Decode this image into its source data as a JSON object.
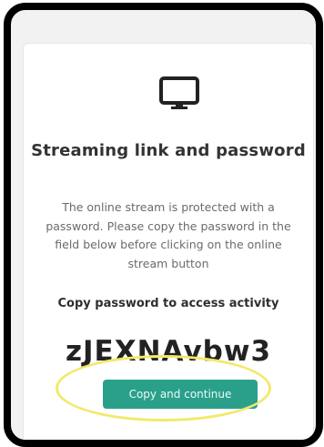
{
  "card": {
    "icon": "monitor-icon",
    "title": "Streaming link and password",
    "description": "The online stream is protected with a password. Please copy the password in the field below before clicking on the online stream button",
    "copy_label": "Copy password to access activity",
    "password": "zJEXNAvbw3",
    "button_label": "Copy and continue"
  },
  "colors": {
    "accent": "#2aa08b",
    "highlight": "#f2e96a",
    "frame": "#000000"
  }
}
